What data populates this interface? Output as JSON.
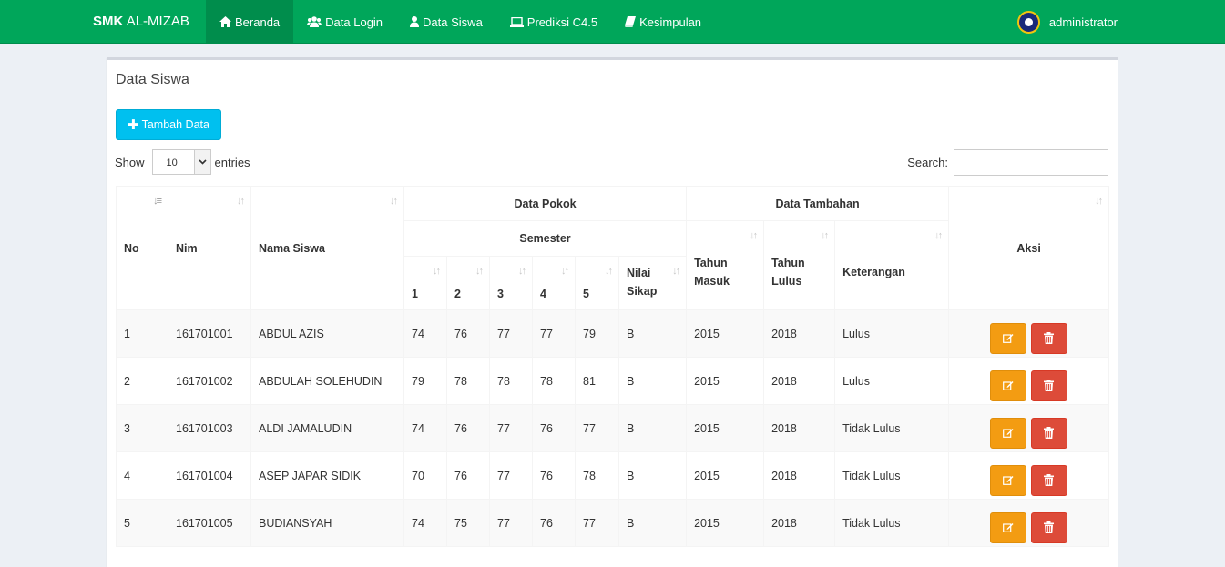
{
  "navbar": {
    "brand_bold": "SMK",
    "brand_rest": "AL-MIZAB",
    "items": [
      {
        "label": "Beranda",
        "icon": "home-icon"
      },
      {
        "label": "Data Login",
        "icon": "users-icon"
      },
      {
        "label": "Data Siswa",
        "icon": "user-icon"
      },
      {
        "label": "Prediksi C4.5",
        "icon": "laptop-icon"
      },
      {
        "label": "Kesimpulan",
        "icon": "book-icon"
      }
    ],
    "active_index": 0,
    "user": "administrator"
  },
  "box": {
    "title": "Data Siswa",
    "add_button": "Tambah Data"
  },
  "datatable": {
    "show_label": "Show",
    "entries_value": "10",
    "entries_label": "entries",
    "search_label": "Search:"
  },
  "table": {
    "headers": {
      "no": "No",
      "nim": "Nim",
      "nama": "Nama Siswa",
      "data_pokok": "Data Pokok",
      "semester": "Semester",
      "s1": "1",
      "s2": "2",
      "s3": "3",
      "s4": "4",
      "s5": "5",
      "nilai_sikap": "Nilai Sikap",
      "data_tambahan": "Data Tambahan",
      "tahun_masuk": "Tahun Masuk",
      "tahun_lulus": "Tahun Lulus",
      "keterangan": "Keterangan",
      "aksi": "Aksi"
    },
    "rows": [
      {
        "no": "1",
        "nim": "161701001",
        "nama": "ABDUL AZIS",
        "s1": "74",
        "s2": "76",
        "s3": "77",
        "s4": "77",
        "s5": "79",
        "sikap": "B",
        "masuk": "2015",
        "lulus": "2018",
        "ket": "Lulus"
      },
      {
        "no": "2",
        "nim": "161701002",
        "nama": "ABDULAH SOLEHUDIN",
        "s1": "79",
        "s2": "78",
        "s3": "78",
        "s4": "78",
        "s5": "81",
        "sikap": "B",
        "masuk": "2015",
        "lulus": "2018",
        "ket": "Lulus"
      },
      {
        "no": "3",
        "nim": "161701003",
        "nama": "ALDI JAMALUDIN",
        "s1": "74",
        "s2": "76",
        "s3": "77",
        "s4": "76",
        "s5": "77",
        "sikap": "B",
        "masuk": "2015",
        "lulus": "2018",
        "ket": "Tidak Lulus"
      },
      {
        "no": "4",
        "nim": "161701004",
        "nama": "ASEP JAPAR SIDIK",
        "s1": "70",
        "s2": "76",
        "s3": "77",
        "s4": "76",
        "s5": "78",
        "sikap": "B",
        "masuk": "2015",
        "lulus": "2018",
        "ket": "Tidak Lulus"
      },
      {
        "no": "5",
        "nim": "161701005",
        "nama": "BUDIANSYAH",
        "s1": "74",
        "s2": "75",
        "s3": "77",
        "s4": "76",
        "s5": "77",
        "sikap": "B",
        "masuk": "2015",
        "lulus": "2018",
        "ket": "Tidak Lulus"
      }
    ]
  },
  "colors": {
    "navbar": "#00a65a",
    "nav_active": "#008d4c",
    "info_button": "#00c0ef",
    "edit_button": "#f39c12",
    "delete_button": "#dd4b39"
  }
}
